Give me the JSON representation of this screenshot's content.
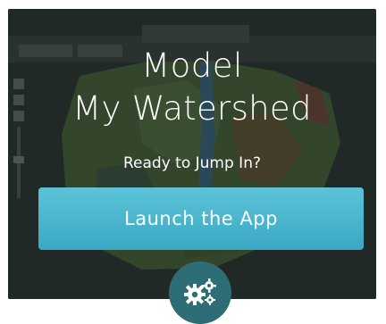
{
  "hero": {
    "title_line1": "Model",
    "title_line2": "My Watershed",
    "tagline": "Ready to Jump In?",
    "launch_label": "Launch the App"
  },
  "badge": {
    "icon": "gears-icon"
  },
  "colors": {
    "button": "#48b5cd",
    "badge": "#2f6d76",
    "background": "#2a3331",
    "text": "#ffffff"
  }
}
